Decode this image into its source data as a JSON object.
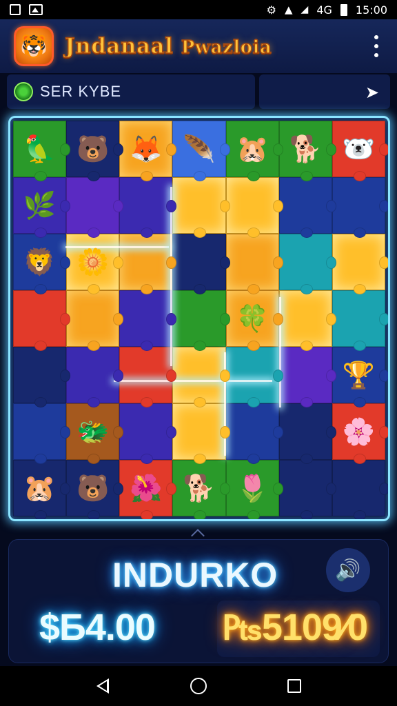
{
  "status_bar": {
    "time": "15:00",
    "carrier_text": "4G",
    "icons": [
      "sim-icon",
      "image-icon",
      "alarm-icon",
      "wifi-icon",
      "signal-icon",
      "battery-icon"
    ]
  },
  "app_bar": {
    "title_main": "Jndanaal",
    "title_secondary": "Pwazloia",
    "logo_glyph": "🐯",
    "menu_icon": "more-vert-icon"
  },
  "sub_bar": {
    "label": "SER KYBE",
    "icon": "spiral-icon",
    "share_icon": "share-icon"
  },
  "board": {
    "rows": 7,
    "cols": 7,
    "pieces": [
      {
        "color": "p-green",
        "glyph": "🦜"
      },
      {
        "color": "p-navy",
        "glyph": "🐻"
      },
      {
        "color": "p-orange",
        "glyph": "🦊"
      },
      {
        "color": "p-sky",
        "glyph": "🪶"
      },
      {
        "color": "p-green",
        "glyph": "🐹"
      },
      {
        "color": "p-green",
        "glyph": "🐕"
      },
      {
        "color": "p-red",
        "glyph": "🐻‍❄️"
      },
      {
        "color": "p-indigo",
        "glyph": "🌿"
      },
      {
        "color": "p-violet",
        "glyph": ""
      },
      {
        "color": "p-indigo",
        "glyph": ""
      },
      {
        "color": "p-gold",
        "glyph": ""
      },
      {
        "color": "p-gold",
        "glyph": ""
      },
      {
        "color": "p-blue",
        "glyph": ""
      },
      {
        "color": "p-blue",
        "glyph": ""
      },
      {
        "color": "p-blue",
        "glyph": "🦁"
      },
      {
        "color": "p-gold",
        "glyph": "🌼"
      },
      {
        "color": "p-orange",
        "glyph": ""
      },
      {
        "color": "p-navy",
        "glyph": ""
      },
      {
        "color": "p-orange",
        "glyph": ""
      },
      {
        "color": "p-teal",
        "glyph": ""
      },
      {
        "color": "p-gold",
        "glyph": ""
      },
      {
        "color": "p-red",
        "glyph": ""
      },
      {
        "color": "p-orange",
        "glyph": ""
      },
      {
        "color": "p-indigo",
        "glyph": ""
      },
      {
        "color": "p-green",
        "glyph": ""
      },
      {
        "color": "p-orange",
        "glyph": "🍀"
      },
      {
        "color": "p-gold",
        "glyph": ""
      },
      {
        "color": "p-teal",
        "glyph": ""
      },
      {
        "color": "p-navy",
        "glyph": ""
      },
      {
        "color": "p-indigo",
        "glyph": ""
      },
      {
        "color": "p-red",
        "glyph": ""
      },
      {
        "color": "p-gold",
        "glyph": ""
      },
      {
        "color": "p-teal",
        "glyph": ""
      },
      {
        "color": "p-violet",
        "glyph": ""
      },
      {
        "color": "p-blue",
        "glyph": "🏆"
      },
      {
        "color": "p-blue",
        "glyph": ""
      },
      {
        "color": "p-brown",
        "glyph": "🐲"
      },
      {
        "color": "p-indigo",
        "glyph": ""
      },
      {
        "color": "p-gold",
        "glyph": ""
      },
      {
        "color": "p-blue",
        "glyph": ""
      },
      {
        "color": "p-navy",
        "glyph": ""
      },
      {
        "color": "p-red",
        "glyph": "🌸"
      },
      {
        "color": "p-navy",
        "glyph": "🐹"
      },
      {
        "color": "p-navy",
        "glyph": "🐻"
      },
      {
        "color": "p-red",
        "glyph": "🌺"
      },
      {
        "color": "p-green",
        "glyph": "🐕"
      },
      {
        "color": "p-green",
        "glyph": "🌷"
      },
      {
        "color": "p-navy",
        "glyph": ""
      },
      {
        "color": "p-navy",
        "glyph": ""
      }
    ]
  },
  "panel": {
    "title": "INDURKO",
    "sound_icon": "sound-icon",
    "score_left": "$Б4.00",
    "score_right": "₧5109⁄0"
  },
  "nav_bar": {
    "icons": [
      "back-icon",
      "home-icon",
      "recents-icon"
    ]
  }
}
